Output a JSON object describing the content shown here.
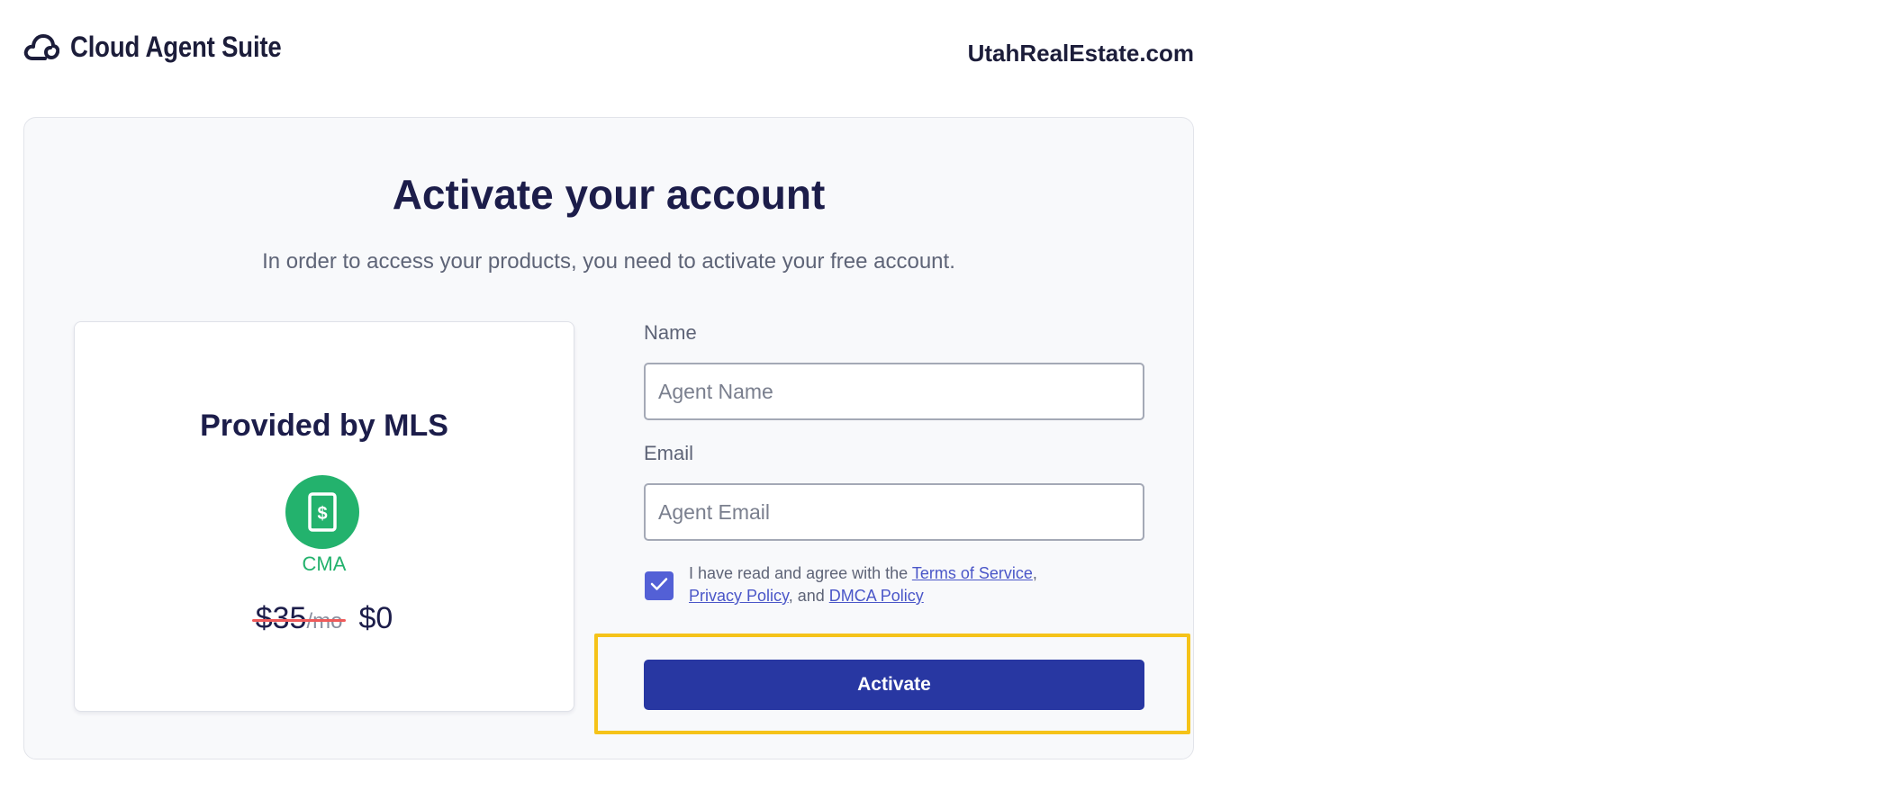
{
  "header": {
    "logo_icon": "cloud-icon",
    "brand_name": "Cloud Agent Suite",
    "site_name": "UtahRealEstate.com"
  },
  "activation": {
    "title": "Activate your account",
    "subtitle": "In order to access your products, you need to activate your free account."
  },
  "plan": {
    "title": "Provided by MLS",
    "icon": "dollar-document-icon",
    "product": "CMA",
    "old_price": "$35",
    "old_period": "/mo",
    "new_price": "$0"
  },
  "form": {
    "name_label": "Name",
    "name_placeholder": "Agent Name",
    "email_label": "Email",
    "email_placeholder": "Agent Email",
    "agree_checked": true,
    "agree_prefix": "I have read and agree with the ",
    "terms_link": "Terms of Service",
    "comma": ",",
    "privacy_link": "Privacy Policy",
    "and_text": ", and ",
    "dmca_link": "DMCA Policy",
    "submit_label": "Activate"
  },
  "colors": {
    "brand_navy": "#2837a2",
    "success_green": "#23b26d",
    "checkbox_blue": "#5360d6",
    "highlight_yellow": "#f5c319",
    "strike_red": "#ef5a5a"
  }
}
